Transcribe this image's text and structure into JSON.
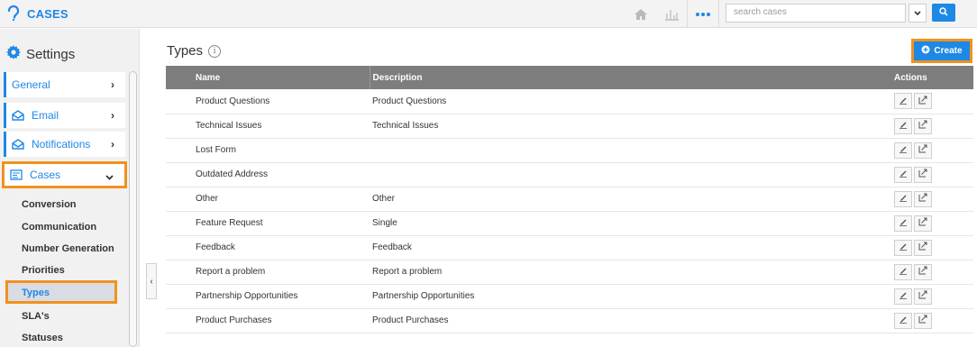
{
  "app": {
    "title": "CASES"
  },
  "topbar": {
    "search_placeholder": "search cases"
  },
  "sidebar": {
    "title": "Settings",
    "nav": [
      {
        "label": "General"
      },
      {
        "label": "Email"
      },
      {
        "label": "Notifications"
      },
      {
        "label": "Cases"
      }
    ],
    "sub_items": [
      "Conversion",
      "Communication",
      "Number Generation",
      "Priorities",
      "Types",
      "SLA's",
      "Statuses"
    ]
  },
  "main": {
    "title": "Types",
    "create_label": "Create",
    "columns": {
      "name": "Name",
      "description": "Description",
      "actions": "Actions"
    },
    "rows": [
      {
        "name": "Product Questions",
        "description": "Product Questions"
      },
      {
        "name": "Technical Issues",
        "description": "Technical Issues"
      },
      {
        "name": "Lost Form",
        "description": ""
      },
      {
        "name": "Outdated Address",
        "description": ""
      },
      {
        "name": "Other",
        "description": "Other"
      },
      {
        "name": "Feature Request",
        "description": "Single"
      },
      {
        "name": "Feedback",
        "description": "Feedback"
      },
      {
        "name": "Report a problem",
        "description": "Report a problem"
      },
      {
        "name": "Partnership Opportunities",
        "description": "Partnership Opportunities"
      },
      {
        "name": "Product Purchases",
        "description": "Product Purchases"
      }
    ]
  },
  "colors": {
    "accent": "#1e88e5",
    "highlight": "#f0921e",
    "header": "#7d7d7d"
  }
}
